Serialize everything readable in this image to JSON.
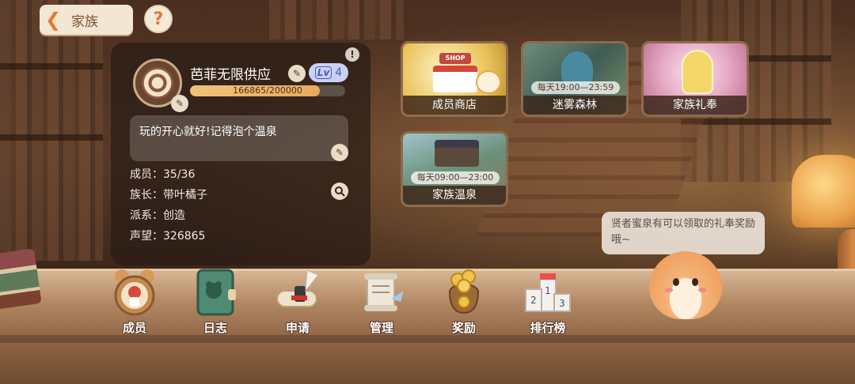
{
  "header": {
    "back_title": "家族",
    "help_glyph": "?"
  },
  "family": {
    "name": "芭菲无限供应",
    "level_prefix": "Lv",
    "level": "4",
    "xp_text": "166865/200000",
    "xp_current": 166865,
    "xp_max": 200000,
    "motto": "玩的开心就好!记得泡个温泉",
    "stats": {
      "members": "成员：35/36",
      "leader": "族长：带叶橘子",
      "faction": "派系：创造",
      "reputation": "声望：326865"
    }
  },
  "cards": [
    {
      "label": "成员商店",
      "time": "",
      "sign": "SHOP"
    },
    {
      "label": "迷雾森林",
      "time": "每天19:00—23:59"
    },
    {
      "label": "家族礼奉",
      "time": ""
    },
    {
      "label": "家族温泉",
      "time": "每天09:00—23:00"
    }
  ],
  "bubble": {
    "text": "贤者蜜泉有可以领取的礼奉奖励哦~"
  },
  "nav": [
    {
      "label": "成员",
      "icon": "member-medal-icon"
    },
    {
      "label": "日志",
      "icon": "journal-book-icon"
    },
    {
      "label": "申请",
      "icon": "application-scroll-icon"
    },
    {
      "label": "管理",
      "icon": "management-scroll-icon"
    },
    {
      "label": "奖励",
      "icon": "reward-coin-bag-icon"
    },
    {
      "label": "排行榜",
      "icon": "leaderboard-podium-icon"
    }
  ],
  "colors": {
    "accent": "#e07b2f",
    "panel": "#281c16",
    "xp_fill": "#e8a95a",
    "level_badge": "#c9d2f3"
  }
}
